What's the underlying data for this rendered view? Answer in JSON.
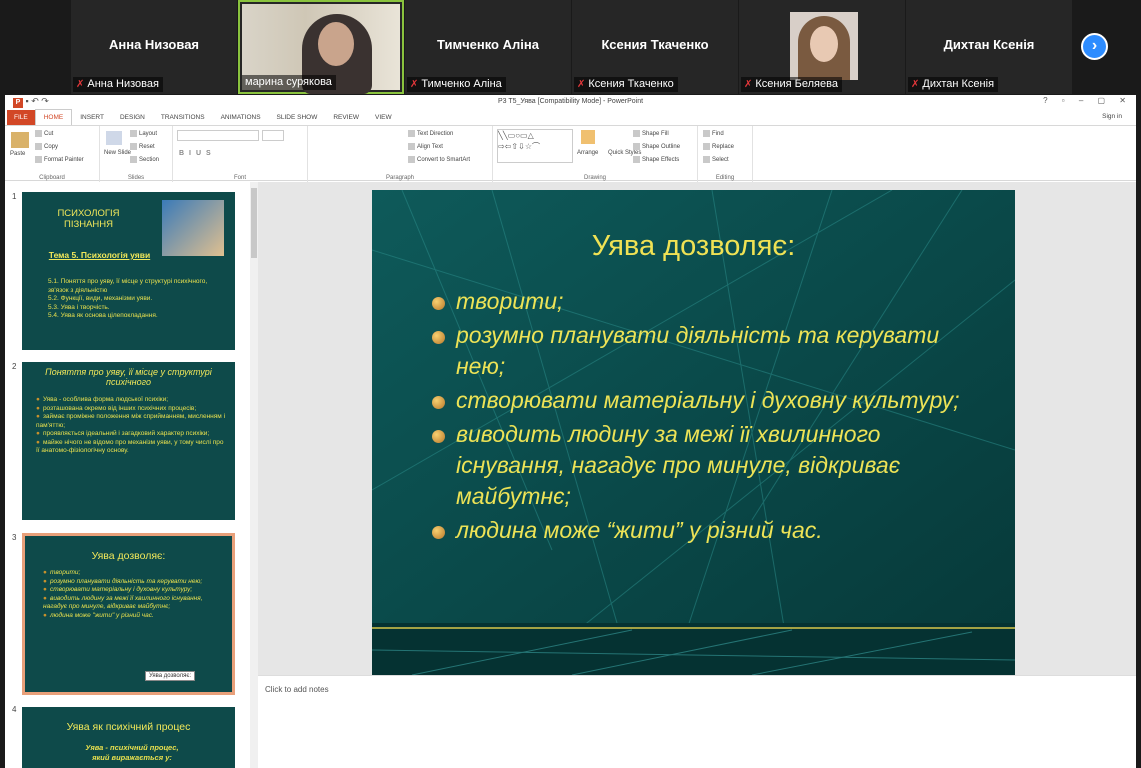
{
  "participants": [
    {
      "name": "Анна Низовая",
      "label": "Анна Низовая",
      "muted": true,
      "video": false
    },
    {
      "name": "марина сурякова",
      "label": "марина сурякова",
      "muted": false,
      "video": true,
      "active": true
    },
    {
      "name": "Тимченко Аліна",
      "label": "Тимченко Аліна",
      "muted": true,
      "video": false
    },
    {
      "name": "Ксения Ткаченко",
      "label": "Ксения Ткаченко",
      "muted": true,
      "video": false
    },
    {
      "name": "Ксения Беляева",
      "label": "Ксения Беляева",
      "muted": true,
      "video": true
    },
    {
      "name": "Дихтан Ксенія",
      "label": "Дихтан Ксенія",
      "muted": true,
      "video": false
    }
  ],
  "ppt": {
    "window_title": "P3 T5_Уява [Compatibility Mode] - PowerPoint",
    "tabs": [
      "FILE",
      "HOME",
      "INSERT",
      "DESIGN",
      "TRANSITIONS",
      "ANIMATIONS",
      "SLIDE SHOW",
      "REVIEW",
      "VIEW"
    ],
    "sign_in": "Sign in",
    "ribbon": {
      "clipboard": {
        "paste": "Paste",
        "cut": "Cut",
        "copy": "Copy",
        "format_painter": "Format Painter",
        "label": "Clipboard"
      },
      "slides": {
        "new_slide": "New Slide",
        "layout": "Layout",
        "reset": "Reset",
        "section": "Section",
        "label": "Slides"
      },
      "font": {
        "label": "Font"
      },
      "paragraph": {
        "text_direction": "Text Direction",
        "align_text": "Align Text",
        "convert": "Convert to SmartArt",
        "label": "Paragraph"
      },
      "drawing": {
        "arrange": "Arrange",
        "quick_styles": "Quick Styles",
        "shape_fill": "Shape Fill",
        "shape_outline": "Shape Outline",
        "shape_effects": "Shape Effects",
        "label": "Drawing"
      },
      "editing": {
        "find": "Find",
        "replace": "Replace",
        "select": "Select",
        "label": "Editing"
      }
    },
    "thumbnails": [
      {
        "num": "1",
        "title": "ПСИХОЛОГІЯ ПІЗНАННЯ",
        "subtitle": "Тема 5. Психологія уяви",
        "items": [
          "5.1. Поняття про уяву, її місце у структурі психічного, зв'язок з діяльністю",
          "5.2. Функції, види, механізми уяви.",
          "5.3. Уява і творчість.",
          "5.4. Уява як основа цілепокладання."
        ]
      },
      {
        "num": "2",
        "title": "Поняття про уяву, її місце у структурі психічного",
        "items": [
          "Уява - особлива форма людської психіки;",
          "розташована окремо від інших психічних процесів;",
          "займає проміжне положення між сприйманням, мисленням і пам'яттю;",
          "проявляється ідеальний і загадковий характер психіки;",
          "майже нічого не відомо про механізм уяви, у тому числі про її анатомо-фізіологічну основу."
        ]
      },
      {
        "num": "3",
        "title": "Уява дозволяє:",
        "items": [
          "творити;",
          "розумно планувати діяльність та керувати нею;",
          "створювати матеріальну і духовну культуру;",
          "виводить людину за межі її хвилинного існування, нагадує про минуле, відкриває майбутнє;",
          "людина може \"жити\" у різний час."
        ]
      },
      {
        "num": "4",
        "title": "Уява як психічний процес",
        "items": [
          "Уява - психічний процес,",
          "який виражається у:"
        ]
      }
    ],
    "tooltip": "Уява  дозволяє:",
    "slide": {
      "title": "Уява  дозволяє:",
      "bullets": [
        "творити;",
        "розумно планувати діяльність та керувати нею;",
        "створювати матеріальну і духовну культуру;",
        "виводить людину за межі її хвилинного існування, нагадує про минуле, відкриває майбутнє;",
        "людина може “жити” у різний час."
      ]
    },
    "notes_placeholder": "Click to add notes"
  }
}
